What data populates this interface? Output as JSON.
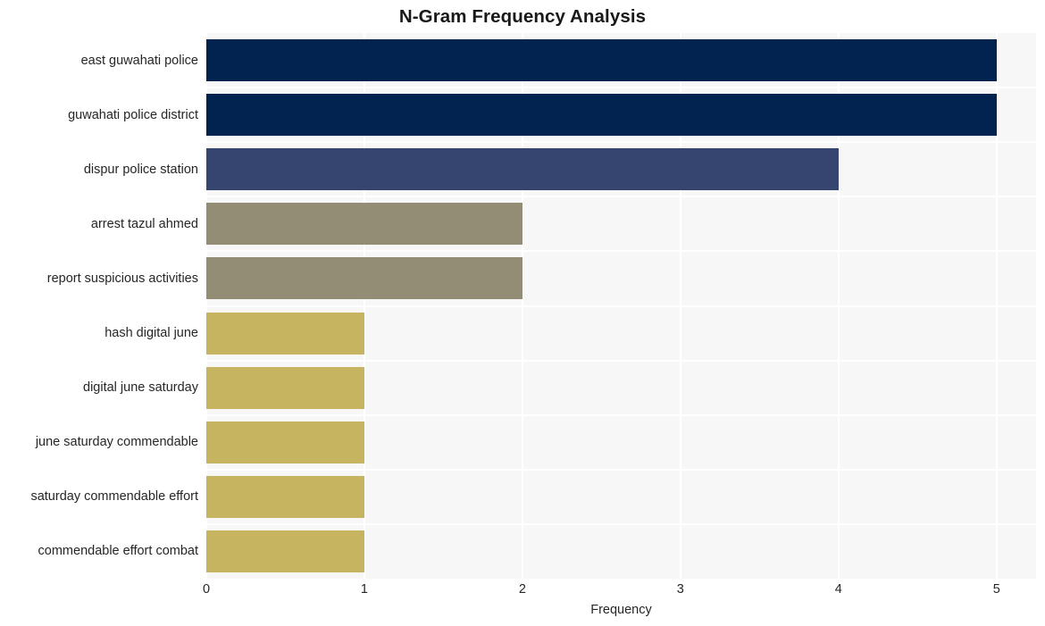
{
  "chart_data": {
    "type": "bar",
    "orientation": "horizontal",
    "title": "N-Gram Frequency Analysis",
    "xlabel": "Frequency",
    "ylabel": "",
    "xlim": [
      0,
      5.25
    ],
    "xticks": [
      0,
      1,
      2,
      3,
      4,
      5
    ],
    "xtick_labels": [
      "0",
      "1",
      "2",
      "3",
      "4",
      "5"
    ],
    "grid": true,
    "legend": false,
    "categories": [
      "east guwahati police",
      "guwahati police district",
      "dispur police station",
      "arrest tazul ahmed",
      "report suspicious activities",
      "hash digital june",
      "digital june saturday",
      "june saturday commendable",
      "saturday commendable effort",
      "commendable effort combat"
    ],
    "values": [
      5,
      5,
      4,
      2,
      2,
      1,
      1,
      1,
      1,
      1
    ],
    "bar_colors": [
      "#022250",
      "#022250",
      "#36456f",
      "#938d75",
      "#938d75",
      "#c6b461",
      "#c6b461",
      "#c6b461",
      "#c6b461",
      "#c6b461"
    ]
  },
  "style": {
    "plot_background": "#f7f7f7",
    "figure_background": "#ffffff",
    "gridline_color": "#ffffff",
    "text_color": "#262626",
    "title_color": "#181818"
  }
}
